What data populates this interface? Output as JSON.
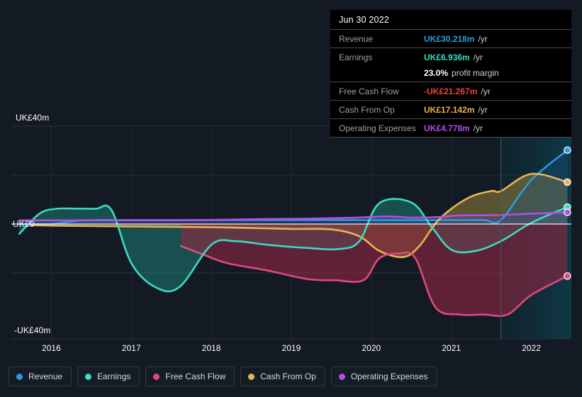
{
  "chart_data": {
    "type": "area",
    "title": "",
    "xlabel": "",
    "ylabel": "",
    "currency": "UK£",
    "units": "m",
    "ylim": [
      -40,
      40
    ],
    "xlim": [
      2015.5,
      2022.5
    ],
    "grid": true,
    "legend_position": "bottom",
    "x_ticks": [
      "2016",
      "2017",
      "2018",
      "2019",
      "2020",
      "2021",
      "2022"
    ],
    "y_ticks": [
      "UK£40m",
      "UK£0",
      "-UK£40m"
    ],
    "forecast_divider_x": 2021.62,
    "series": [
      {
        "name": "Revenue",
        "color": "#2d9ae0",
        "x": [
          2015.6,
          2016.0,
          2016.4,
          2017.0,
          2018.0,
          2019.0,
          2020.0,
          2020.6,
          2021.0,
          2021.4,
          2021.62,
          2022.0,
          2022.45
        ],
        "values": [
          0.0,
          0.0,
          1.5,
          1.6,
          1.6,
          1.6,
          1.6,
          1.6,
          1.6,
          1.6,
          1.7,
          18.0,
          30.218
        ],
        "end_value": 30.218,
        "end_label": "UK£30.218m /yr"
      },
      {
        "name": "Earnings",
        "color": "#3ddbc0",
        "x": [
          2015.6,
          2015.85,
          2016.05,
          2016.3,
          2016.55,
          2016.75,
          2017.0,
          2017.3,
          2017.6,
          2018.0,
          2018.3,
          2018.7,
          2019.2,
          2019.6,
          2019.85,
          2020.1,
          2020.5,
          2020.75,
          2021.0,
          2021.3,
          2021.62,
          2022.0,
          2022.45
        ],
        "values": [
          -4.0,
          4.2,
          6.2,
          6.3,
          6.2,
          5.8,
          -16.0,
          -25.8,
          -25.8,
          -8.5,
          -7.0,
          -8.5,
          -9.8,
          -10.2,
          -7.0,
          8.5,
          8.8,
          -1.0,
          -10.5,
          -11.0,
          -7.0,
          0.5,
          6.936
        ],
        "end_value": 6.936,
        "end_label": "UK£6.936m /yr"
      },
      {
        "name": "Free Cash Flow",
        "color": "#e0487f",
        "x": [
          2017.62,
          2017.9,
          2018.2,
          2018.7,
          2019.2,
          2019.55,
          2019.9,
          2020.1,
          2020.35,
          2020.55,
          2020.8,
          2021.1,
          2021.4,
          2021.7,
          2022.0,
          2022.45
        ],
        "values": [
          -9.0,
          -12.5,
          -16.0,
          -19.0,
          -22.5,
          -23.0,
          -23.0,
          -14.0,
          -12.0,
          -14.0,
          -34.0,
          -37.0,
          -37.0,
          -37.0,
          -29.0,
          -21.267
        ],
        "end_value": -21.267,
        "end_label": "-UK£21.267m /yr"
      },
      {
        "name": "Cash From Op",
        "color": "#e8b457",
        "x": [
          2015.75,
          2016.1,
          2017.0,
          2018.0,
          2019.0,
          2019.5,
          2019.85,
          2020.1,
          2020.4,
          2020.6,
          2020.85,
          2021.2,
          2021.5,
          2021.62,
          2022.0,
          2022.45
        ],
        "values": [
          -0.5,
          -0.7,
          -1.0,
          -1.3,
          -2.0,
          -2.2,
          -5.0,
          -11.0,
          -13.5,
          -9.0,
          2.0,
          10.5,
          13.5,
          13.5,
          20.5,
          17.142
        ],
        "end_value": 17.142,
        "end_label": "UK£17.142m /yr"
      },
      {
        "name": "Operating Expenses",
        "color": "#b34fe8",
        "x": [
          2015.6,
          2017.3,
          2018.0,
          2018.6,
          2019.2,
          2019.8,
          2020.2,
          2020.5,
          2020.8,
          2021.1,
          2021.4,
          2021.62,
          2022.0,
          2022.45
        ],
        "values": [
          1.5,
          1.5,
          1.7,
          2.0,
          2.2,
          2.6,
          3.1,
          2.6,
          2.8,
          3.5,
          3.6,
          3.7,
          4.2,
          4.778
        ],
        "end_value": 4.778,
        "end_label": "UK£4.778m /yr"
      }
    ]
  },
  "tooltip": {
    "date": "Jun 30 2022",
    "rows": [
      {
        "name": "Revenue",
        "value": "UK£30.218m",
        "suffix": "/yr",
        "color": "#2d9ae0"
      },
      {
        "name": "Earnings",
        "value": "UK£6.936m",
        "suffix": "/yr",
        "color": "#3ddbc0"
      },
      {
        "name": "",
        "value": "23.0%",
        "suffix": "profit margin",
        "color": "#ffffff"
      },
      {
        "name": "Free Cash Flow",
        "value": "-UK£21.267m",
        "suffix": "/yr",
        "color": "#e8453c"
      },
      {
        "name": "Cash From Op",
        "value": "UK£17.142m",
        "suffix": "/yr",
        "color": "#e8b457"
      },
      {
        "name": "Operating Expenses",
        "value": "UK£4.778m",
        "suffix": "/yr",
        "color": "#b34fe8"
      }
    ]
  },
  "legend": {
    "items": [
      {
        "label": "Revenue",
        "color": "#2d9ae0"
      },
      {
        "label": "Earnings",
        "color": "#3ddbc0"
      },
      {
        "label": "Free Cash Flow",
        "color": "#e0487f"
      },
      {
        "label": "Cash From Op",
        "color": "#e8b457"
      },
      {
        "label": "Operating Expenses",
        "color": "#b34fe8"
      }
    ]
  },
  "axis": {
    "y_top": "UK£40m",
    "y_zero": "UK£0",
    "y_bottom": "-UK£40m",
    "x_ticks": [
      "2016",
      "2017",
      "2018",
      "2019",
      "2020",
      "2021",
      "2022"
    ]
  },
  "colors": {
    "background": "#131a24",
    "plot_background": "#131a24",
    "forecast_background": "#0d2430",
    "gridline": "#2b323c",
    "zero_line": "#ffffff",
    "tooltip_background": "#000000"
  }
}
